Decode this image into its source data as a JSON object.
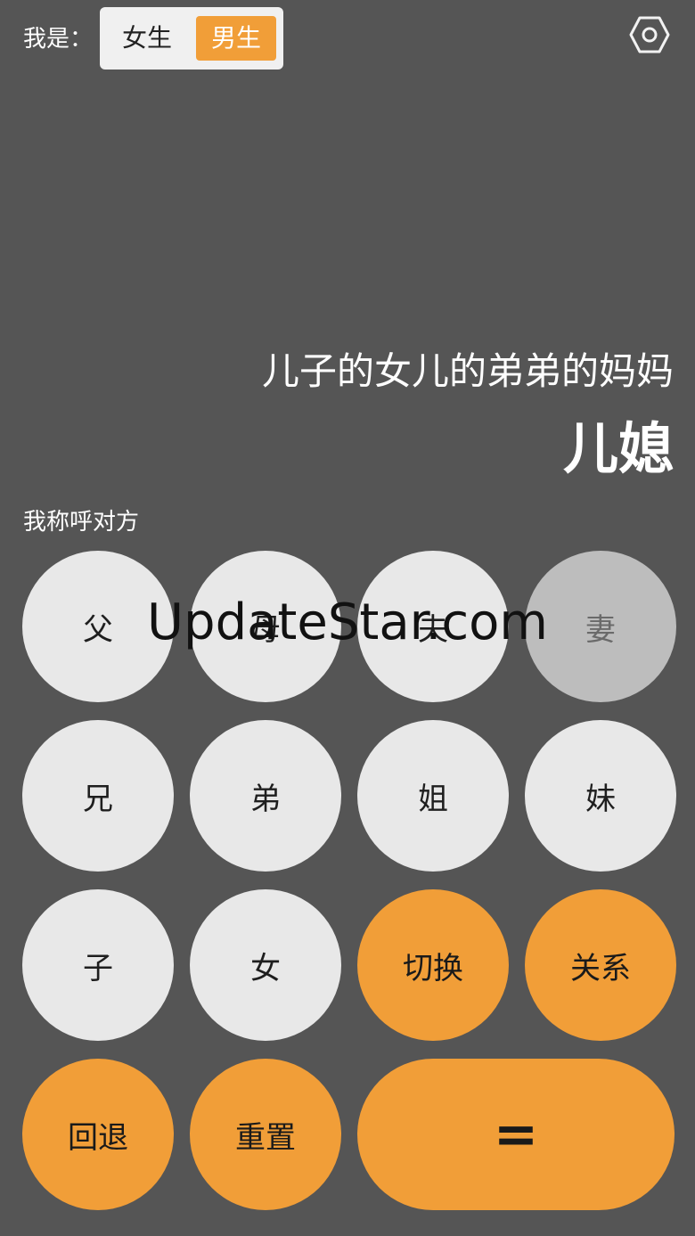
{
  "header": {
    "me_label": "我是：",
    "gender_options": {
      "female": "女生",
      "male": "男生"
    },
    "selected_gender": "男生",
    "settings_icon": "settings-hexagon-icon"
  },
  "display": {
    "expression": "儿子的女儿的弟弟的妈妈",
    "result": "儿媳"
  },
  "mode_label": "我称呼对方",
  "keypad": {
    "father": "父",
    "mother": "母",
    "husband": "夫",
    "wife": "妻",
    "elder_brother": "兄",
    "younger_brother": "弟",
    "elder_sister": "姐",
    "younger_sister": "妹",
    "son": "子",
    "daughter": "女",
    "switch": "切换",
    "relation": "关系",
    "back": "回退",
    "reset": "重置",
    "equals": "="
  },
  "watermark": "UpdateStar.com",
  "colors": {
    "background": "#555555",
    "accent": "#f19e38",
    "key": "#e8e8e8",
    "key_disabled": "#bdbdbd"
  }
}
